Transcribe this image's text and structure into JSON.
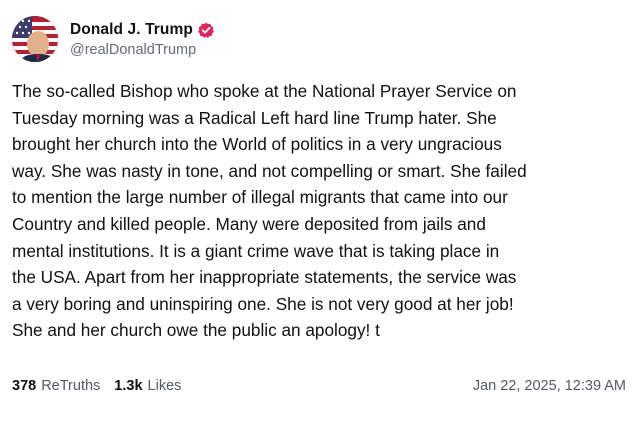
{
  "post": {
    "author": {
      "display_name": "Donald J. Trump",
      "handle": "@realDonaldTrump",
      "verified": true,
      "verified_color": "#e0245e"
    },
    "text": "The so-called Bishop who spoke at the National Prayer Service on\nTuesday morning was a Radical Left hard line Trump hater. She\nbrought her church into the World of politics in a very ungracious\nway. She was nasty in tone, and not compelling or smart. She failed\nto mention the large number of illegal migrants that came into our\nCountry and killed people. Many were deposited from jails and\nmental institutions. It is a giant crime wave that is taking place in\nthe USA. Apart from her inappropriate statements, the service was\na very boring and uninspiring one. She is not very good at her job!\nShe and her church owe the public an apology! t",
    "stats": {
      "retruths_count": "378",
      "retruths_label": "ReTruths",
      "likes_count": "1.3k",
      "likes_label": "Likes"
    },
    "timestamp": "Jan 22, 2025, 12:39 AM"
  },
  "icons": {
    "avatar": "flag-portrait-avatar",
    "verified": "verified-badge-icon"
  }
}
